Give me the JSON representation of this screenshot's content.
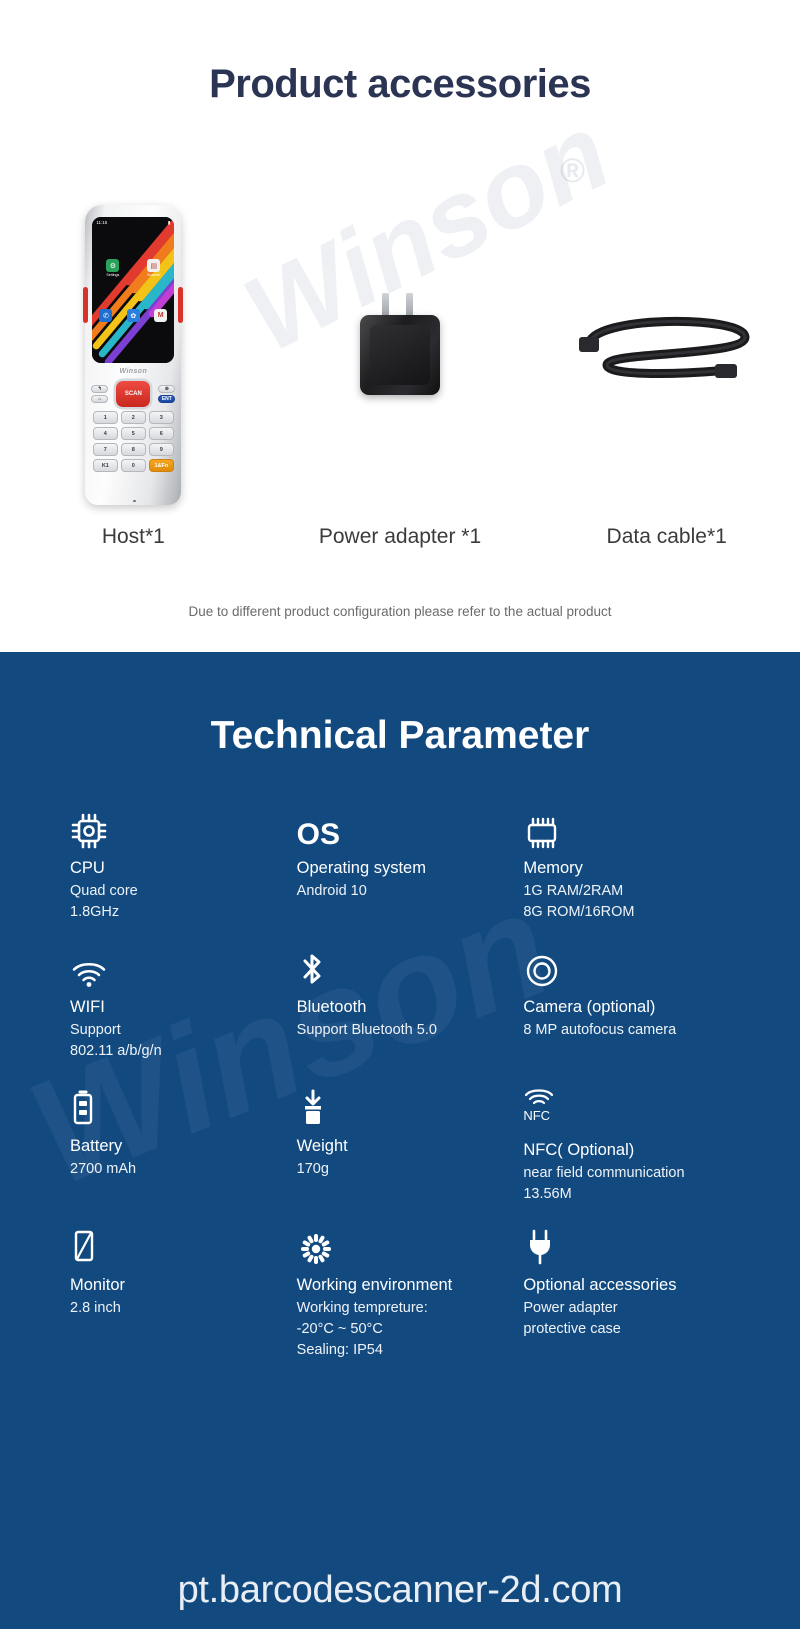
{
  "accessories_section": {
    "title": "Product accessories",
    "watermark": "Winson",
    "watermark_mark": "®",
    "items": [
      {
        "label": "Host*1",
        "icon": "handheld-terminal-image"
      },
      {
        "label": "Power adapter *1",
        "icon": "power-adapter-image"
      },
      {
        "label": "Data cable*1",
        "icon": "usb-data-cable-image"
      }
    ],
    "note": "Due to different product configuration please refer to the actual product",
    "device_screen": {
      "status_time": "11:15",
      "apps_row1": [
        {
          "label": "Settings",
          "icon": "settings-gear-icon"
        },
        {
          "label": "Scanner",
          "icon": "scanner-icon"
        }
      ],
      "apps_row2": [
        {
          "label": "",
          "icon": "phone-icon"
        },
        {
          "label": "",
          "icon": "browser-icon"
        },
        {
          "label": "",
          "icon": "m-app-icon"
        }
      ],
      "brand": "Winson",
      "keys": {
        "scan": "SCAN",
        "enter": "ENT",
        "keypad": [
          "1",
          "2",
          "3",
          "4",
          "5",
          "6",
          "7",
          "8",
          "9",
          "K1",
          "0",
          "1&Fn"
        ]
      }
    }
  },
  "technical_section": {
    "title": "Technical Parameter",
    "background_color": "#124a80",
    "specs": [
      {
        "icon": "cpu-chip-icon",
        "name": "CPU",
        "lines": [
          "Quad core",
          "1.8GHz"
        ]
      },
      {
        "icon": "os-text-icon",
        "icon_text": "OS",
        "name": "Operating system",
        "lines": [
          "Android 10"
        ]
      },
      {
        "icon": "memory-chip-icon",
        "name": "Memory",
        "lines": [
          "1G RAM/2RAM",
          "8G ROM/16ROM"
        ]
      },
      {
        "icon": "wifi-icon",
        "name": "WIFI",
        "lines": [
          "Support",
          "802.11  a/b/g/n"
        ]
      },
      {
        "icon": "bluetooth-icon",
        "name": "Bluetooth",
        "lines": [
          "Support Bluetooth 5.0"
        ]
      },
      {
        "icon": "camera-lens-icon",
        "name": "Camera (optional)",
        "lines": [
          "8 MP autofocus camera"
        ]
      },
      {
        "icon": "battery-icon",
        "name": "Battery",
        "lines": [
          "2700 mAh"
        ]
      },
      {
        "icon": "weight-box-icon",
        "name": "Weight",
        "lines": [
          "170g"
        ]
      },
      {
        "icon": "nfc-wave-icon",
        "icon_text": "NFC",
        "name": "NFC( Optional)",
        "lines": [
          "near field communication",
          "13.56M"
        ]
      },
      {
        "icon": "monitor-screen-icon",
        "name": "Monitor",
        "lines": [
          "2.8 inch"
        ]
      },
      {
        "icon": "sun-burst-icon",
        "name": "Working environment",
        "lines": [
          "Working tempreture:",
          "-20°C ~ 50°C",
          "Sealing: IP54"
        ]
      },
      {
        "icon": "power-plug-icon",
        "name": "Optional accessories",
        "lines": [
          "Power adapter",
          "protective case"
        ]
      }
    ]
  },
  "footer": {
    "url": "pt.barcodescanner-2d.com"
  }
}
